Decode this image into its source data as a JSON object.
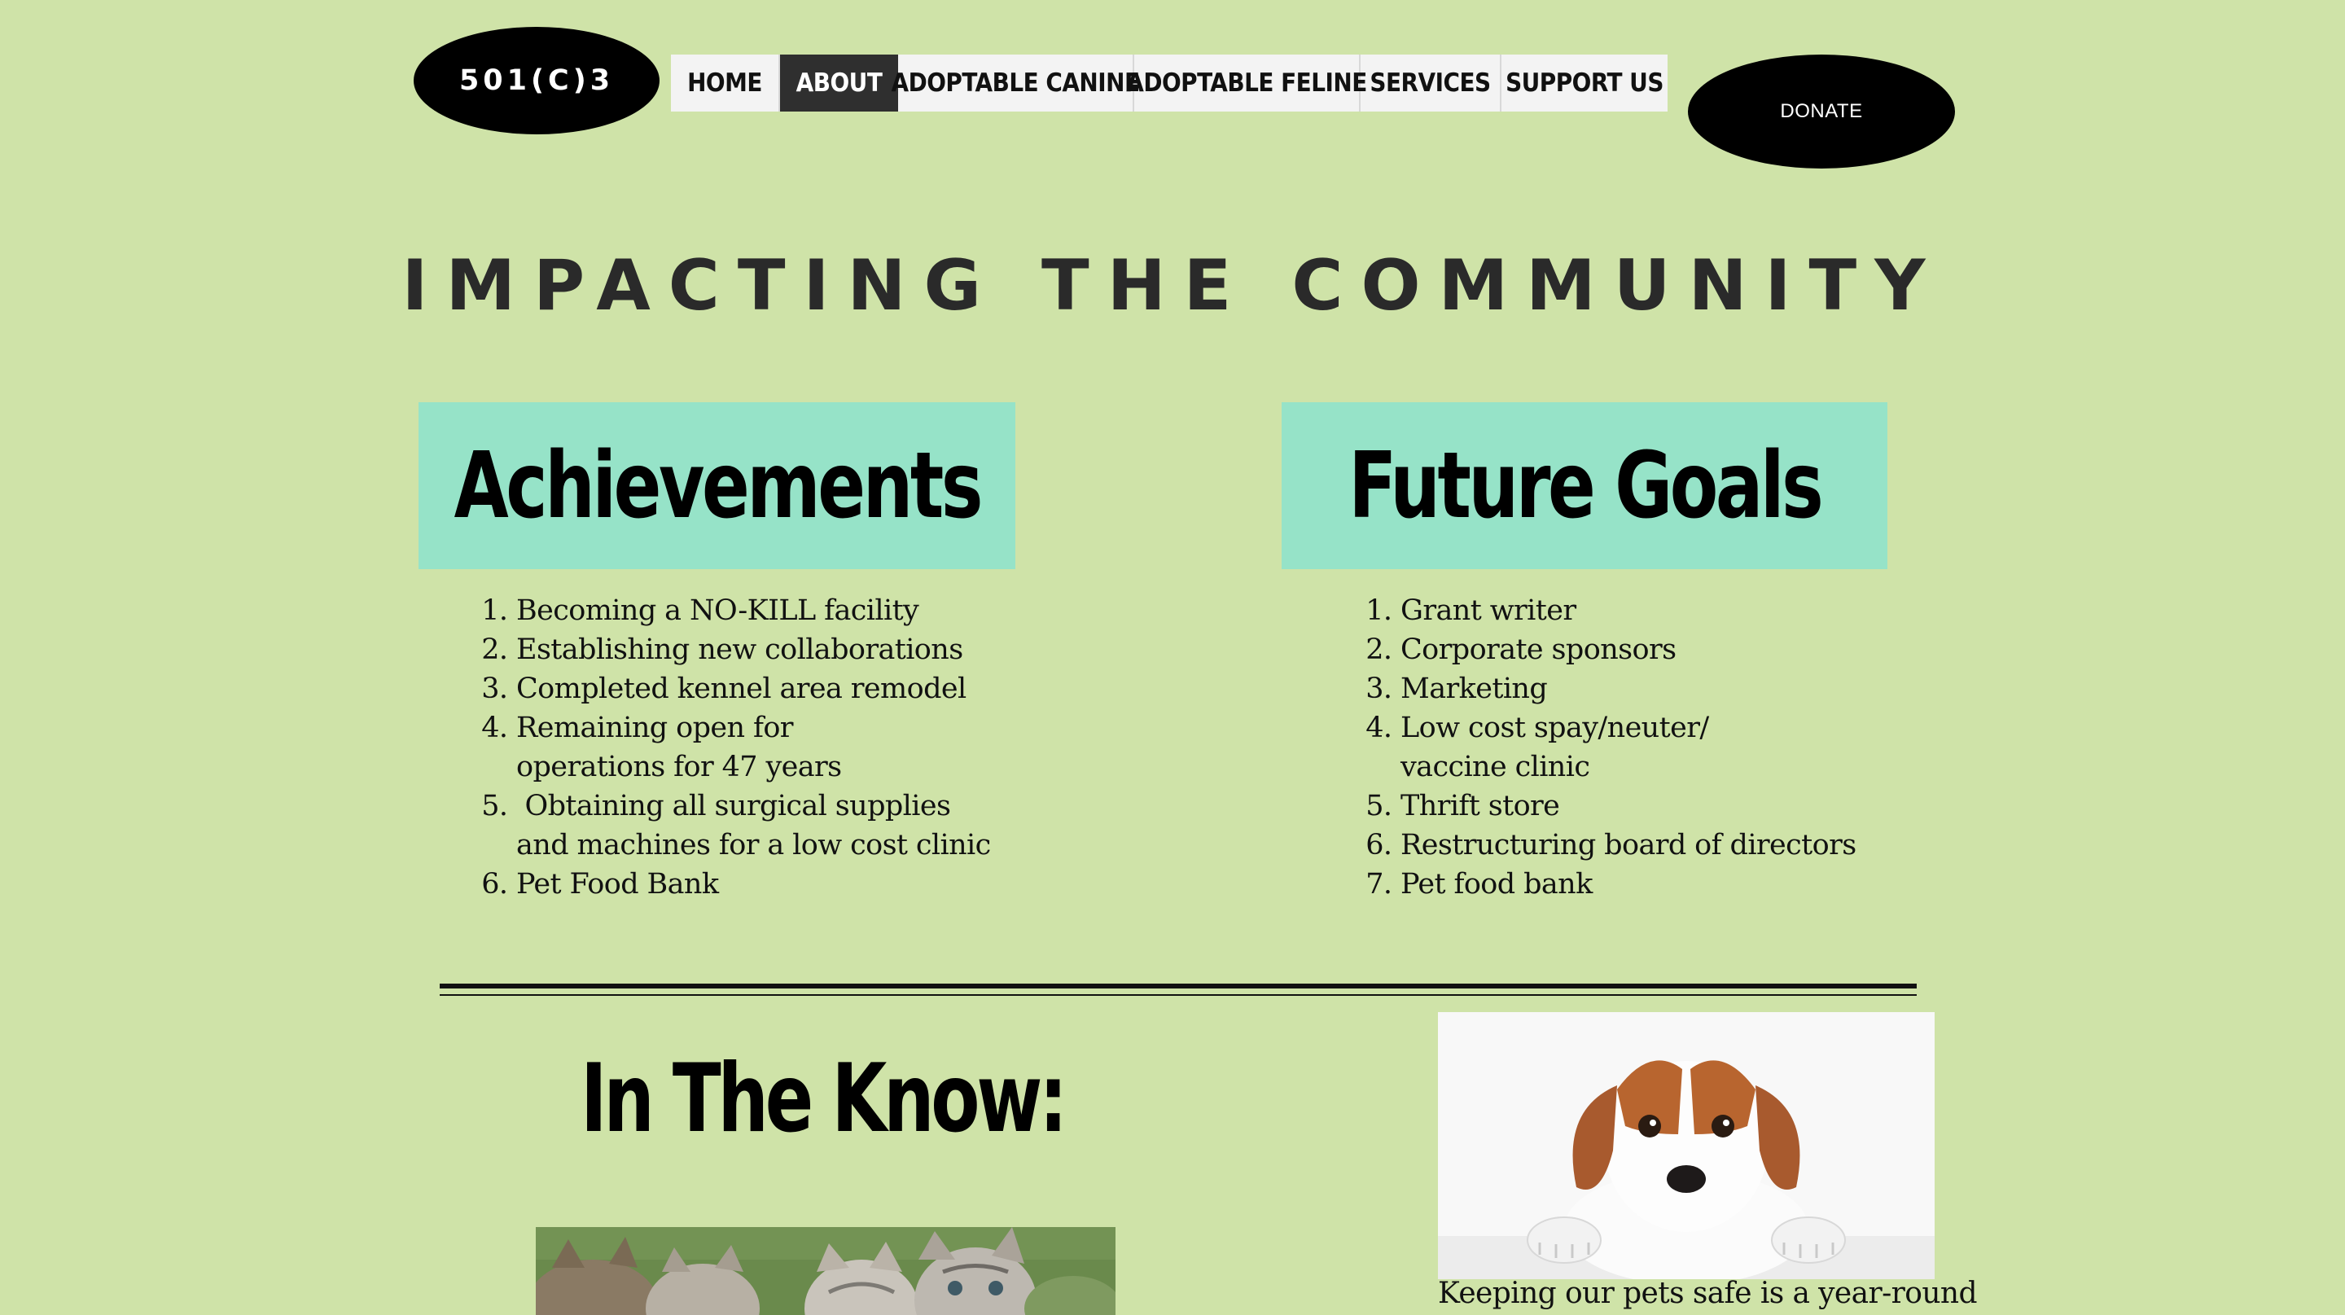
{
  "header": {
    "logo_text": "501(C)3",
    "donate_label": "DONATE"
  },
  "nav": {
    "items": [
      {
        "label": "HOME",
        "active": false
      },
      {
        "label": "ABOUT",
        "active": true
      },
      {
        "label": "ADOPTABLE CANINE",
        "active": false
      },
      {
        "label": "ADOPTABLE FELINE",
        "active": false
      },
      {
        "label": "SERVICES",
        "active": false
      },
      {
        "label": "SUPPORT US",
        "active": false
      }
    ]
  },
  "main": {
    "title": "IMPACTING THE COMMUNITY",
    "achievements": {
      "heading": "Achievements",
      "items": [
        "Becoming a NO-KILL facility",
        "Establishing new collaborations",
        "Completed kennel area remodel",
        "Remaining open for operations for 47 years",
        " Obtaining all surgical supplies and machines for a low cost clinic",
        "Pet Food Bank"
      ]
    },
    "goals": {
      "heading": "Future Goals",
      "items": [
        "Grant writer",
        "Corporate sponsors",
        "Marketing",
        "Low cost spay/neuter/ vaccine clinic",
        "Thrift store",
        "Restructuring board of directors",
        "Pet food bank"
      ]
    },
    "know": {
      "heading": "In The Know:",
      "caption": "Keeping our pets safe is a year-round"
    }
  },
  "colors": {
    "background": "#cfe3a8",
    "box": "#96e3c8",
    "nav_active": "#2f2f2f",
    "logo": "#000000"
  }
}
